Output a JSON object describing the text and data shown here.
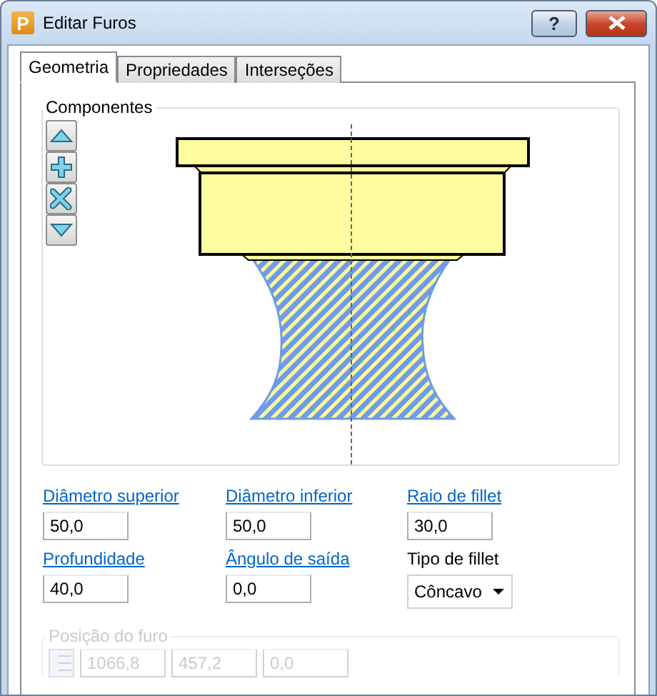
{
  "window": {
    "icon_letter": "P",
    "title": "Editar Furos",
    "help_label": "?"
  },
  "tabs": [
    {
      "label": "Geometria",
      "selected": true
    },
    {
      "label": "Propriedades",
      "selected": false
    },
    {
      "label": "Interseções",
      "selected": false
    }
  ],
  "components": {
    "title": "Componentes"
  },
  "fields": [
    {
      "kind": "link",
      "label": "Diâmetro superior",
      "value": "50,0"
    },
    {
      "kind": "link",
      "label": "Diâmetro inferior",
      "value": "50,0"
    },
    {
      "kind": "link",
      "label": "Raio de fillet",
      "value": "30,0"
    },
    {
      "kind": "link",
      "label": "Profundidade",
      "value": "40,0"
    },
    {
      "kind": "link",
      "label": "Ângulo de saída",
      "value": "0,0"
    },
    {
      "kind": "dropdown",
      "label": "Tipo de fillet",
      "value": "Côncavo"
    }
  ],
  "position": {
    "title": "Posição do furo",
    "disabled": true,
    "values": [
      "1066,8",
      "457,2",
      "0,0"
    ]
  }
}
